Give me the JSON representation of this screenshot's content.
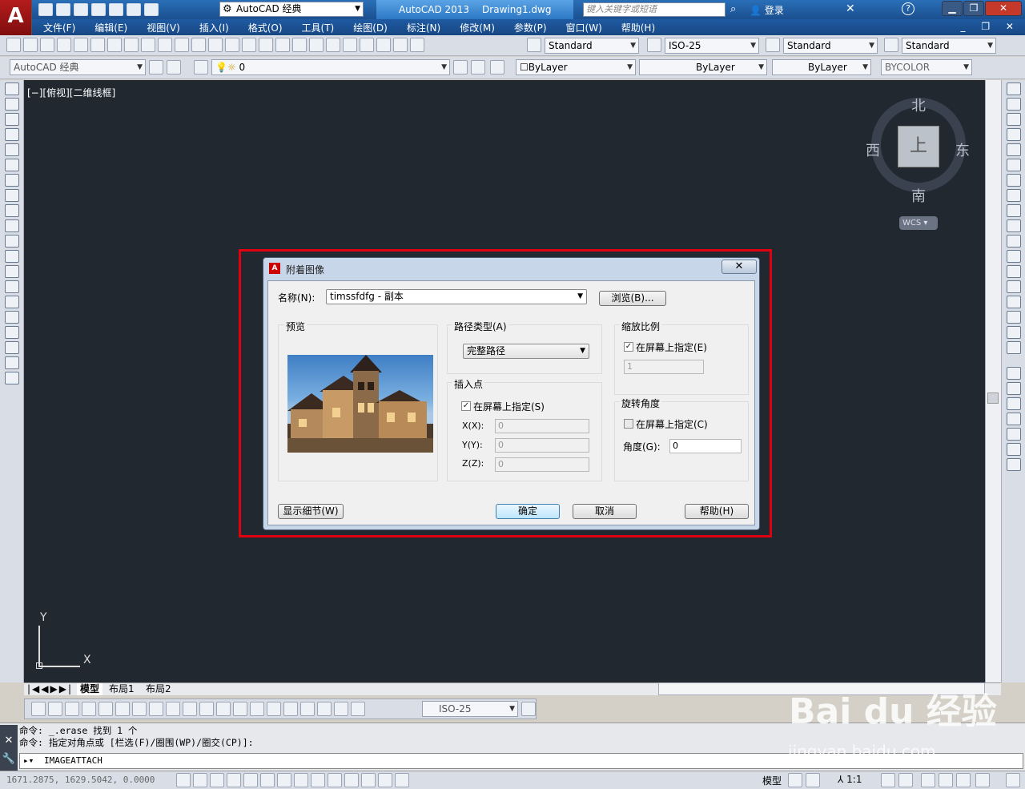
{
  "titlebar": {
    "workspace": "AutoCAD 经典",
    "app_name": "AutoCAD 2013",
    "file_name": "Drawing1.dwg",
    "search_placeholder": "键入关键字或短语",
    "login": "登录",
    "help": "?"
  },
  "menubar": {
    "items": [
      "文件(F)",
      "编辑(E)",
      "视图(V)",
      "插入(I)",
      "格式(O)",
      "工具(T)",
      "绘图(D)",
      "标注(N)",
      "修改(M)",
      "参数(P)",
      "窗口(W)",
      "帮助(H)"
    ]
  },
  "styles": {
    "text_style": "Standard",
    "dim_style": "ISO-25",
    "table_style": "Standard",
    "mleader_style": "Standard"
  },
  "workspace2": "AutoCAD 经典",
  "layer": {
    "current": "0"
  },
  "props": {
    "color": "ByLayer",
    "linetype": "ByLayer",
    "lineweight": "ByLayer",
    "plotstyle": "BYCOLOR"
  },
  "viewport": {
    "label": "[−][俯视][二维线框]"
  },
  "viewcube": {
    "north": "北",
    "south": "南",
    "east": "东",
    "west": "西",
    "face": "上",
    "wcs": "WCS"
  },
  "ucs": {
    "x": "X",
    "y": "Y"
  },
  "layout_tabs": [
    "模型",
    "布局1",
    "布局2"
  ],
  "dim_toolbar": {
    "style": "ISO-25"
  },
  "command": {
    "history": [
      "命令: _.erase 找到 1 个",
      "命令: 指定对角点或 [栏选(F)/圈围(WP)/圈交(CP)]:"
    ],
    "input": "IMAGEATTACH"
  },
  "statusbar": {
    "coords": "1671.2875, 1629.5042, 0.0000",
    "model": "模型",
    "scale": "1:1"
  },
  "dialog": {
    "title": "附着图像",
    "close": "✕",
    "name_label": "名称(N):",
    "name_value": "timssfdfg - 副本",
    "browse": "浏览(B)...",
    "preview_label": "预览",
    "path_type_label": "路径类型(A)",
    "path_type_value": "完整路径",
    "insert_label": "插入点",
    "insert_onscreen": "在屏幕上指定(S)",
    "x_label": "X(X):",
    "y_label": "Y(Y):",
    "z_label": "Z(Z):",
    "x_value": "0",
    "y_value": "0",
    "z_value": "0",
    "scale_label": "缩放比例",
    "scale_onscreen": "在屏幕上指定(E)",
    "scale_value": "1",
    "rotation_label": "旋转角度",
    "rotation_onscreen": "在屏幕上指定(C)",
    "angle_label": "角度(G):",
    "angle_value": "0",
    "details": "显示细节(W)",
    "ok": "确定",
    "cancel": "取消",
    "help": "帮助(H)"
  },
  "watermark": {
    "brand": "Bai du 经验",
    "url": "jingyan.baidu.com"
  },
  "colors": {
    "canvas": "#212830",
    "highlight": "#e00010",
    "title_bar": "#1b4f8f"
  }
}
